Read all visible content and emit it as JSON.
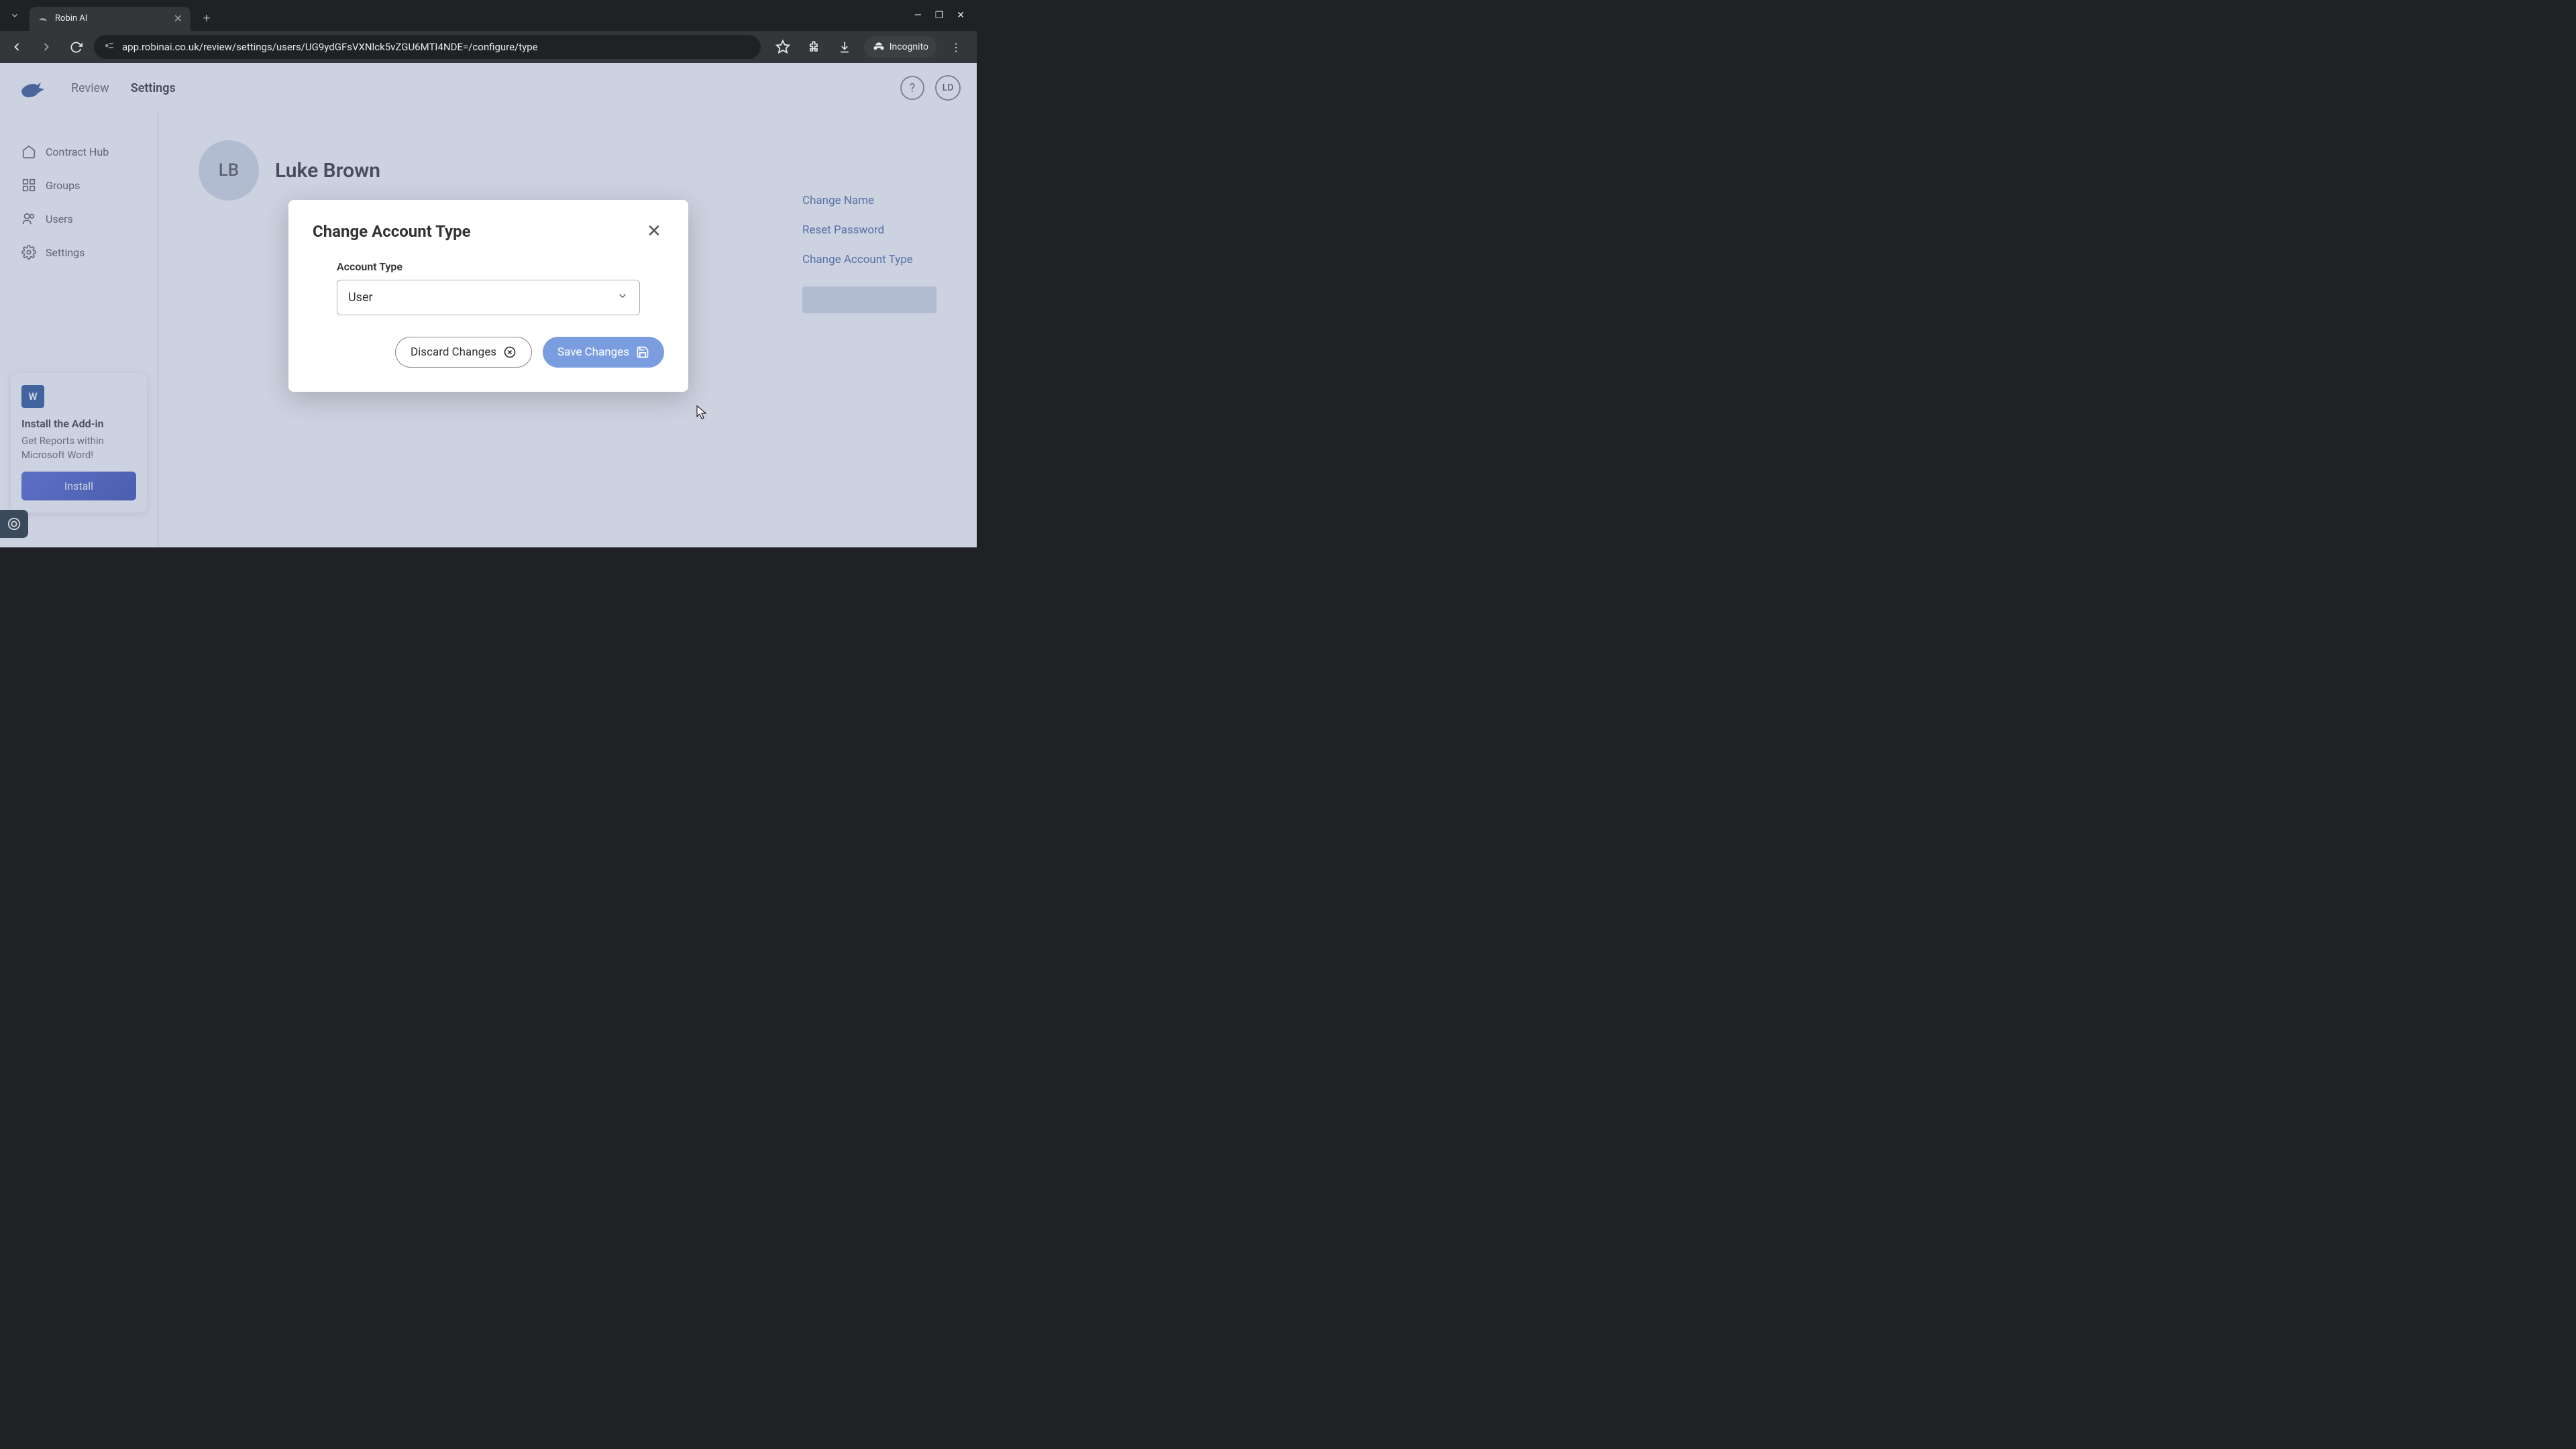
{
  "browser": {
    "tab_title": "Robin AI",
    "url": "app.robinai.co.uk/review/settings/users/UG9ydGFsVXNlck5vZGU6MTI4NDE=/configure/type",
    "incognito_label": "Incognito"
  },
  "header": {
    "nav": {
      "review": "Review",
      "settings": "Settings"
    },
    "avatar_initials": "LD"
  },
  "sidebar": {
    "items": [
      {
        "label": "Contract Hub"
      },
      {
        "label": "Groups"
      },
      {
        "label": "Users"
      },
      {
        "label": "Settings"
      }
    ],
    "addin": {
      "title": "Install the Add-in",
      "desc": "Get Reports within Microsoft Word!",
      "button": "Install",
      "word_glyph": "W"
    }
  },
  "main": {
    "user_initials": "LB",
    "user_name": "Luke Brown",
    "actions": {
      "change_name": "Change Name",
      "reset_password": "Reset Password",
      "change_type": "Change Account Type"
    }
  },
  "modal": {
    "title": "Change Account Type",
    "field_label": "Account Type",
    "selected": "User",
    "discard": "Discard Changes",
    "save": "Save Changes"
  }
}
